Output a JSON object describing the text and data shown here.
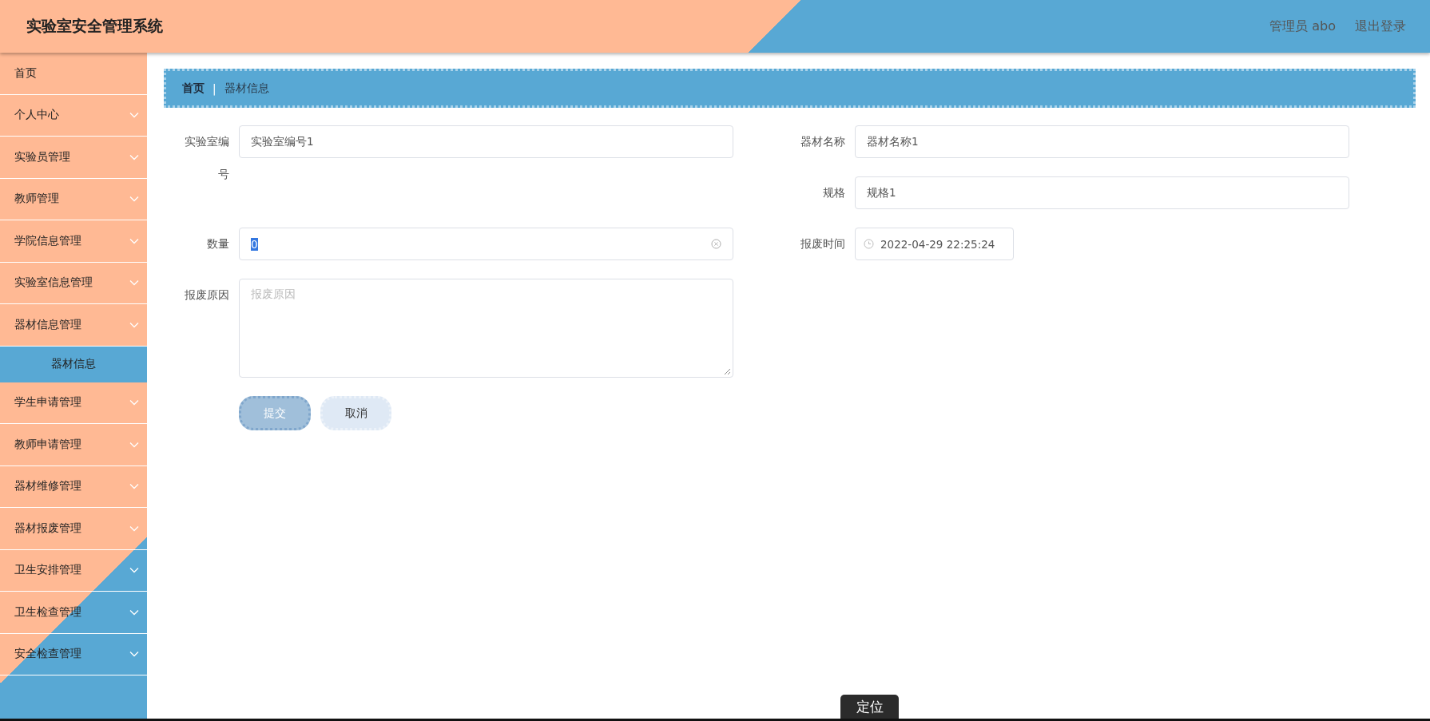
{
  "header": {
    "title": "实验室安全管理系统",
    "user": "管理员 abo",
    "logout": "退出登录"
  },
  "sidebar": {
    "items": [
      {
        "kind": "link",
        "label": "首页"
      },
      {
        "kind": "menu",
        "label": "个人中心"
      },
      {
        "kind": "menu",
        "label": "实验员管理"
      },
      {
        "kind": "menu",
        "label": "教师管理"
      },
      {
        "kind": "menu",
        "label": "学院信息管理"
      },
      {
        "kind": "menu",
        "label": "实验室信息管理"
      },
      {
        "kind": "menu",
        "label": "器材信息管理",
        "children": [
          {
            "label": "器材信息",
            "selected": true
          }
        ]
      },
      {
        "kind": "menu",
        "label": "学生申请管理"
      },
      {
        "kind": "menu",
        "label": "教师申请管理"
      },
      {
        "kind": "menu",
        "label": "器材维修管理"
      },
      {
        "kind": "menu",
        "label": "器材报废管理"
      },
      {
        "kind": "menu",
        "label": "卫生安排管理"
      },
      {
        "kind": "menu",
        "label": "卫生检查管理"
      },
      {
        "kind": "menu",
        "label": "安全检查管理"
      }
    ]
  },
  "breadcrumb": {
    "items": [
      "首页",
      "器材信息"
    ],
    "separator": "|"
  },
  "form": {
    "left": [
      {
        "kind": "text",
        "label": "实验室编号",
        "value": "实验室编号1"
      },
      {
        "kind": "number",
        "label": "数量",
        "value": "0",
        "text_selected": true
      },
      {
        "kind": "textarea",
        "label": "报废原因",
        "placeholder": "报废原因"
      }
    ],
    "right": [
      {
        "kind": "text",
        "label": "器材名称",
        "value": "器材名称1"
      },
      {
        "kind": "text",
        "label": "规格",
        "value": "规格1"
      },
      {
        "kind": "datetime",
        "label": "报废时间",
        "value": "2022-04-29 22:25:24"
      }
    ],
    "buttons": [
      {
        "kind": "primary",
        "label": "提交"
      },
      {
        "kind": "secondary",
        "label": "取消"
      }
    ]
  },
  "floating_button": "定位"
}
